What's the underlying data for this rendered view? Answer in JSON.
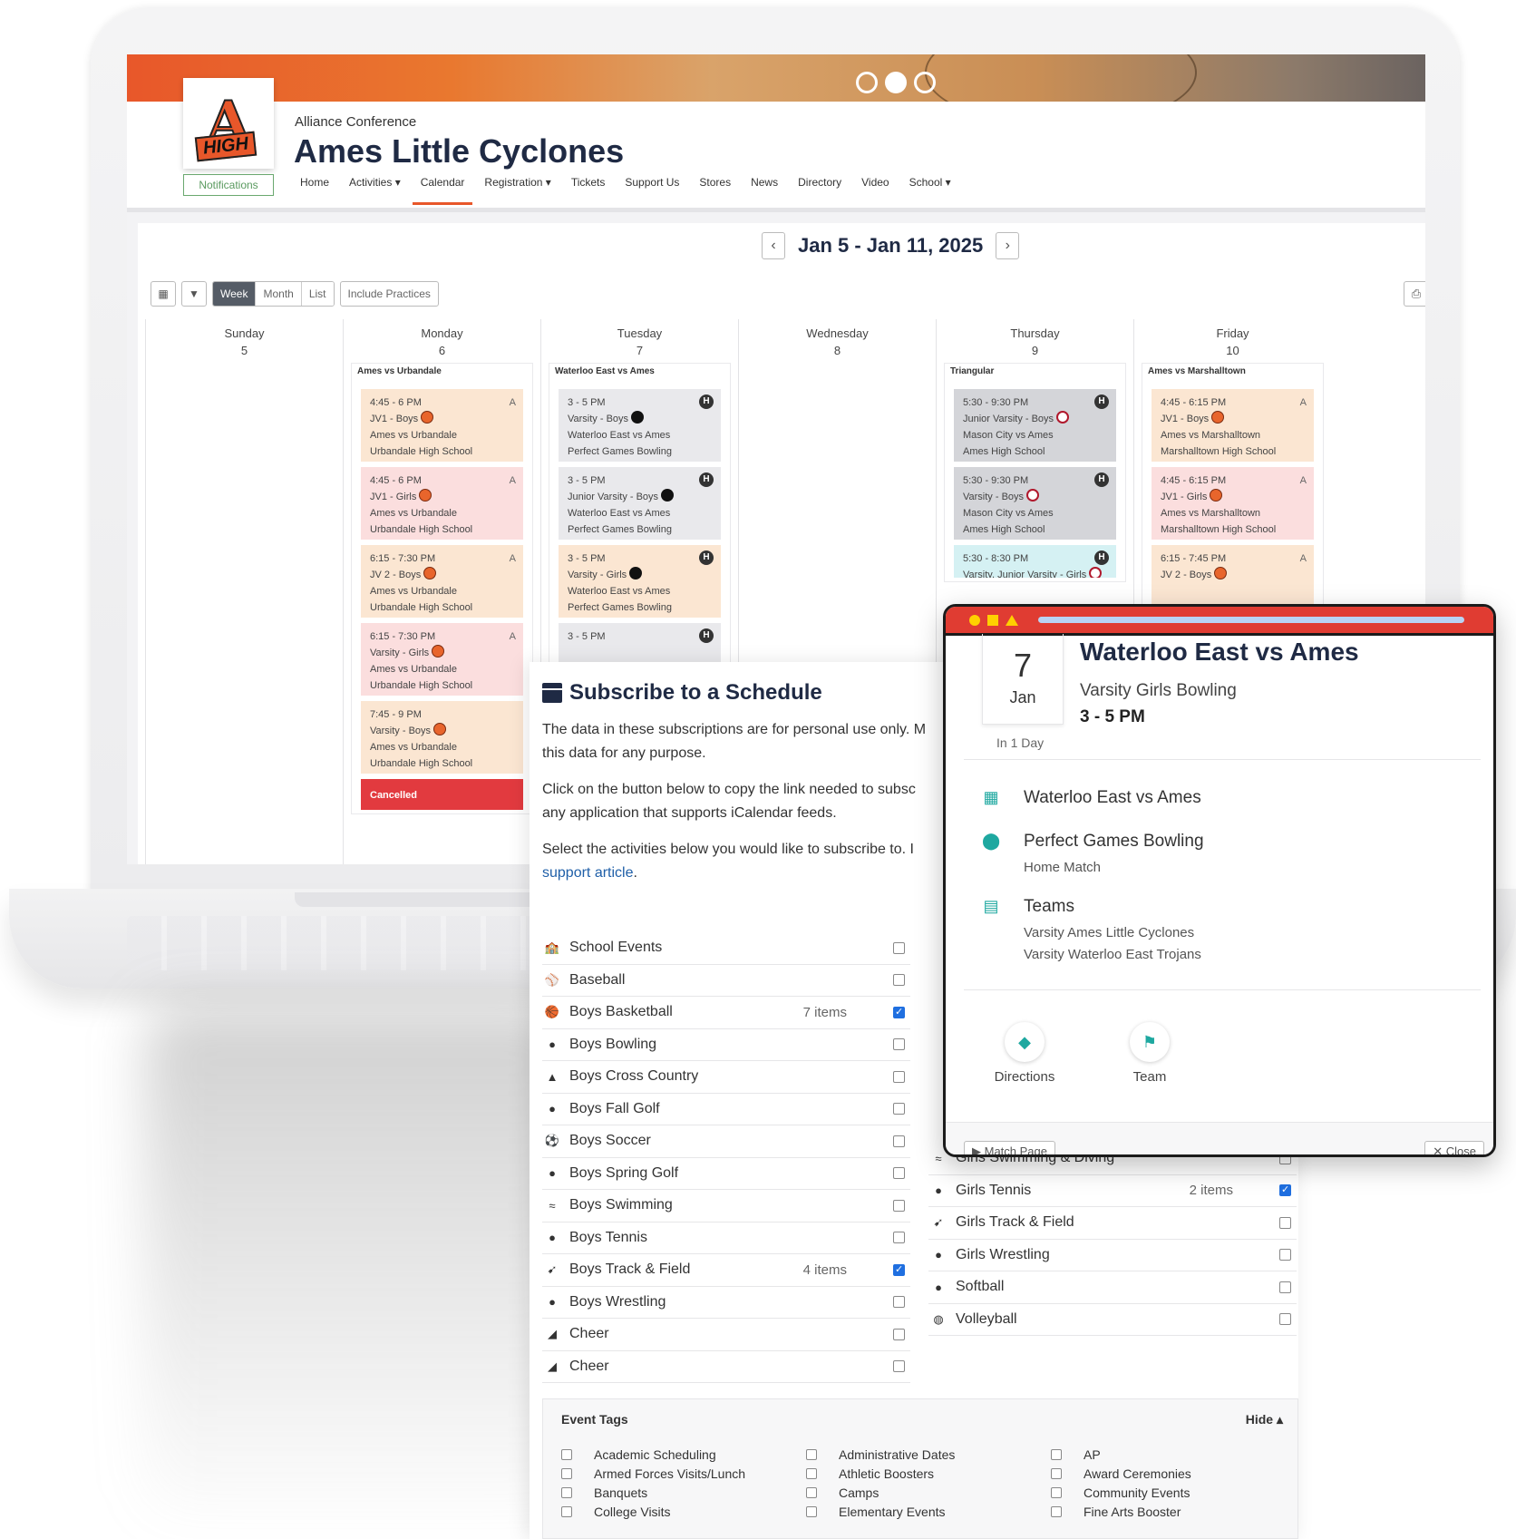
{
  "site": {
    "conference": "Alliance Conference",
    "title": "Ames Little Cyclones",
    "notifications": "Notifications",
    "logo_letter": "A",
    "logo_word": "HIGH",
    "nav": [
      "Home",
      "Activities ▾",
      "Calendar",
      "Registration ▾",
      "Tickets",
      "Support Us",
      "Stores",
      "News",
      "Directory",
      "Video",
      "School ▾"
    ]
  },
  "calendar": {
    "range": "Jan 5 - Jan 11, 2025",
    "prev": "‹",
    "next": "›",
    "views": [
      "Week",
      "Month",
      "List"
    ],
    "include_practices": "Include Practices",
    "days": [
      {
        "name": "Sunday",
        "num": "5",
        "group": "",
        "events": []
      },
      {
        "name": "Monday",
        "num": "6",
        "group": "Ames vs Urbandale",
        "events": [
          {
            "time": "4:45 - 6 PM",
            "team": "JV1 - Boys",
            "match": "Ames vs Urbandale",
            "place": "Urbandale High School",
            "tag": "A",
            "color": "orange",
            "icon": "bb"
          },
          {
            "time": "4:45 - 6 PM",
            "team": "JV1 - Girls",
            "match": "Ames vs Urbandale",
            "place": "Urbandale High School",
            "tag": "A",
            "color": "pink",
            "icon": "bb"
          },
          {
            "time": "6:15 - 7:30 PM",
            "team": "JV 2 - Boys",
            "match": "Ames vs Urbandale",
            "place": "Urbandale High School",
            "tag": "A",
            "color": "orange",
            "icon": "bb"
          },
          {
            "time": "6:15 - 7:30 PM",
            "team": "Varsity - Girls",
            "match": "Ames vs Urbandale",
            "place": "Urbandale High School",
            "tag": "A",
            "color": "pink",
            "icon": "bb"
          },
          {
            "time": "7:45 - 9 PM",
            "team": "Varsity - Boys",
            "match": "Ames vs Urbandale",
            "place": "Urbandale High School",
            "tag": "",
            "color": "orange",
            "icon": "bb"
          }
        ],
        "cancelled": "Cancelled"
      },
      {
        "name": "Tuesday",
        "num": "7",
        "group": "Waterloo East vs Ames",
        "events": [
          {
            "time": "3 - 5 PM",
            "team": "Varsity - Boys",
            "match": "Waterloo East vs Ames",
            "place": "Perfect Games Bowling",
            "tag": "H",
            "color": "gray",
            "icon": "bw"
          },
          {
            "time": "3 - 5 PM",
            "team": "Junior Varsity - Boys",
            "match": "Waterloo East vs Ames",
            "place": "Perfect Games Bowling",
            "tag": "H",
            "color": "gray",
            "icon": "bw"
          },
          {
            "time": "3 - 5 PM",
            "team": "Varsity - Girls",
            "match": "Waterloo East vs Ames",
            "place": "Perfect Games Bowling",
            "tag": "H",
            "color": "orange",
            "icon": "bw"
          },
          {
            "time": "3 - 5 PM",
            "team": "",
            "match": "",
            "place": "",
            "tag": "H",
            "color": "gray",
            "icon": ""
          }
        ]
      },
      {
        "name": "Wednesday",
        "num": "8",
        "group": "",
        "events": []
      },
      {
        "name": "Thursday",
        "num": "9",
        "group": "Triangular",
        "events": [
          {
            "time": "5:30 - 9:30 PM",
            "team": "Junior Varsity - Boys",
            "match": "Mason City vs Ames",
            "place": "Ames High School",
            "tag": "H",
            "color": "dgray",
            "icon": "wr"
          },
          {
            "time": "5:30 - 9:30 PM",
            "team": "Varsity - Boys",
            "match": "Mason City vs Ames",
            "place": "Ames High School",
            "tag": "H",
            "color": "dgray",
            "icon": "wr"
          },
          {
            "time": "5:30 - 8:30 PM",
            "team": "Varsity, Junior Varsity - Girls",
            "match": "",
            "place": "",
            "tag": "H",
            "color": "teal",
            "icon": "wr"
          }
        ]
      },
      {
        "name": "Friday",
        "num": "10",
        "group": "Ames vs Marshalltown",
        "events": [
          {
            "time": "4:45 - 6:15 PM",
            "team": "JV1 - Boys",
            "match": "Ames vs Marshalltown",
            "place": "Marshalltown High School",
            "tag": "A",
            "color": "orange",
            "icon": "bb"
          },
          {
            "time": "4:45 - 6:15 PM",
            "team": "JV1 - Girls",
            "match": "Ames vs Marshalltown",
            "place": "Marshalltown High School",
            "tag": "A",
            "color": "pink",
            "icon": "bb"
          },
          {
            "time": "6:15 - 7:45 PM",
            "team": "JV 2 - Boys",
            "match": "",
            "place": "",
            "tag": "A",
            "color": "orange",
            "icon": "bb"
          }
        ]
      }
    ]
  },
  "subscribe": {
    "title": "Subscribe to a Schedule",
    "p1": "The data in these subscriptions are for personal use only. M",
    "p1b": "this data for any purpose.",
    "p2": "Click on the button below to copy the link needed to subsc",
    "p2b": "any application that supports iCalendar feeds.",
    "p3": "Select the activities below you would like to subscribe to. I",
    "link": "support article",
    "link_suffix": ".",
    "left": [
      {
        "name": "School Events",
        "count": "",
        "checked": false,
        "icon": "🏫"
      },
      {
        "name": "Baseball",
        "count": "",
        "checked": false,
        "icon": "⚾"
      },
      {
        "name": "Boys Basketball",
        "count": "7 items",
        "checked": true,
        "icon": "🏀"
      },
      {
        "name": "Boys Bowling",
        "count": "",
        "checked": false,
        "icon": "●"
      },
      {
        "name": "Boys Cross Country",
        "count": "",
        "checked": false,
        "icon": "▲"
      },
      {
        "name": "Boys Fall Golf",
        "count": "",
        "checked": false,
        "icon": "●"
      },
      {
        "name": "Boys Soccer",
        "count": "",
        "checked": false,
        "icon": "⚽"
      },
      {
        "name": "Boys Spring Golf",
        "count": "",
        "checked": false,
        "icon": "●"
      },
      {
        "name": "Boys Swimming",
        "count": "",
        "checked": false,
        "icon": "≈"
      },
      {
        "name": "Boys Tennis",
        "count": "",
        "checked": false,
        "icon": "●"
      },
      {
        "name": "Boys Track & Field",
        "count": "4 items",
        "checked": true,
        "icon": "➹"
      },
      {
        "name": "Boys Wrestling",
        "count": "",
        "checked": false,
        "icon": "●"
      },
      {
        "name": "Cheer",
        "count": "",
        "checked": false,
        "icon": "◢"
      },
      {
        "name": "Cheer",
        "count": "",
        "checked": false,
        "icon": "◢"
      }
    ],
    "right": [
      {
        "name": "Girls Swimming & Diving",
        "count": "",
        "checked": false,
        "icon": "≈"
      },
      {
        "name": "Girls Tennis",
        "count": "2 items",
        "checked": true,
        "icon": "●"
      },
      {
        "name": "Girls Track & Field",
        "count": "",
        "checked": false,
        "icon": "➹"
      },
      {
        "name": "Girls Wrestling",
        "count": "",
        "checked": false,
        "icon": "●"
      },
      {
        "name": "Softball",
        "count": "",
        "checked": false,
        "icon": "●"
      },
      {
        "name": "Volleyball",
        "count": "",
        "checked": false,
        "icon": "◍"
      }
    ],
    "tags_title": "Event Tags",
    "tags_toggle": "Hide ▴",
    "tags": [
      "Academic Scheduling",
      "Administrative Dates",
      "AP",
      "Armed Forces Visits/Lunch",
      "Athletic Boosters",
      "Award Ceremonies",
      "Banquets",
      "Camps",
      "Community Events",
      "College Visits",
      "Elementary Events",
      "Fine Arts Booster"
    ]
  },
  "modal": {
    "day": "7",
    "month": "Jan",
    "relative": "In 1 Day",
    "title": "Waterloo East vs Ames",
    "subtitle": "Varsity Girls Bowling",
    "time": "3 - 5 PM",
    "event_name": "Waterloo East vs Ames",
    "location": "Perfect Games Bowling",
    "location_note": "Home Match",
    "teams_label": "Teams",
    "team1": "Varsity Ames Little Cyclones",
    "team2": "Varsity Waterloo East Trojans",
    "action_directions": "Directions",
    "action_team": "Team",
    "footer_left": "▶ Match Page",
    "footer_right": "✕ Close"
  },
  "colors": {
    "accent": "#e8572a",
    "navy": "#1f2a44",
    "teal": "#1ea8a0",
    "modal_bar": "#e03c32"
  }
}
